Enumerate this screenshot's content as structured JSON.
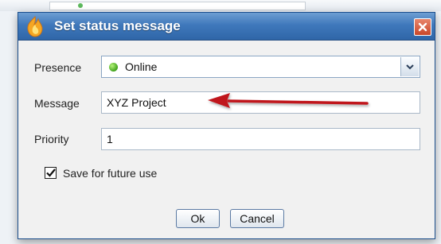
{
  "dialog": {
    "title": "Set status message",
    "close_icon": "close-icon",
    "app_icon": "flame-icon"
  },
  "form": {
    "presence": {
      "label": "Presence",
      "value": "Online",
      "status_color": "#3fa11b"
    },
    "message": {
      "label": "Message",
      "value": "XYZ Project"
    },
    "priority": {
      "label": "Priority",
      "value": "1"
    },
    "save": {
      "label": "Save for future use",
      "checked": true
    }
  },
  "buttons": {
    "ok": "Ok",
    "cancel": "Cancel"
  },
  "annotation": {
    "arrow_color": "#c0161c"
  },
  "colors": {
    "titlebar": "#3f78bb",
    "close": "#c9472a"
  }
}
